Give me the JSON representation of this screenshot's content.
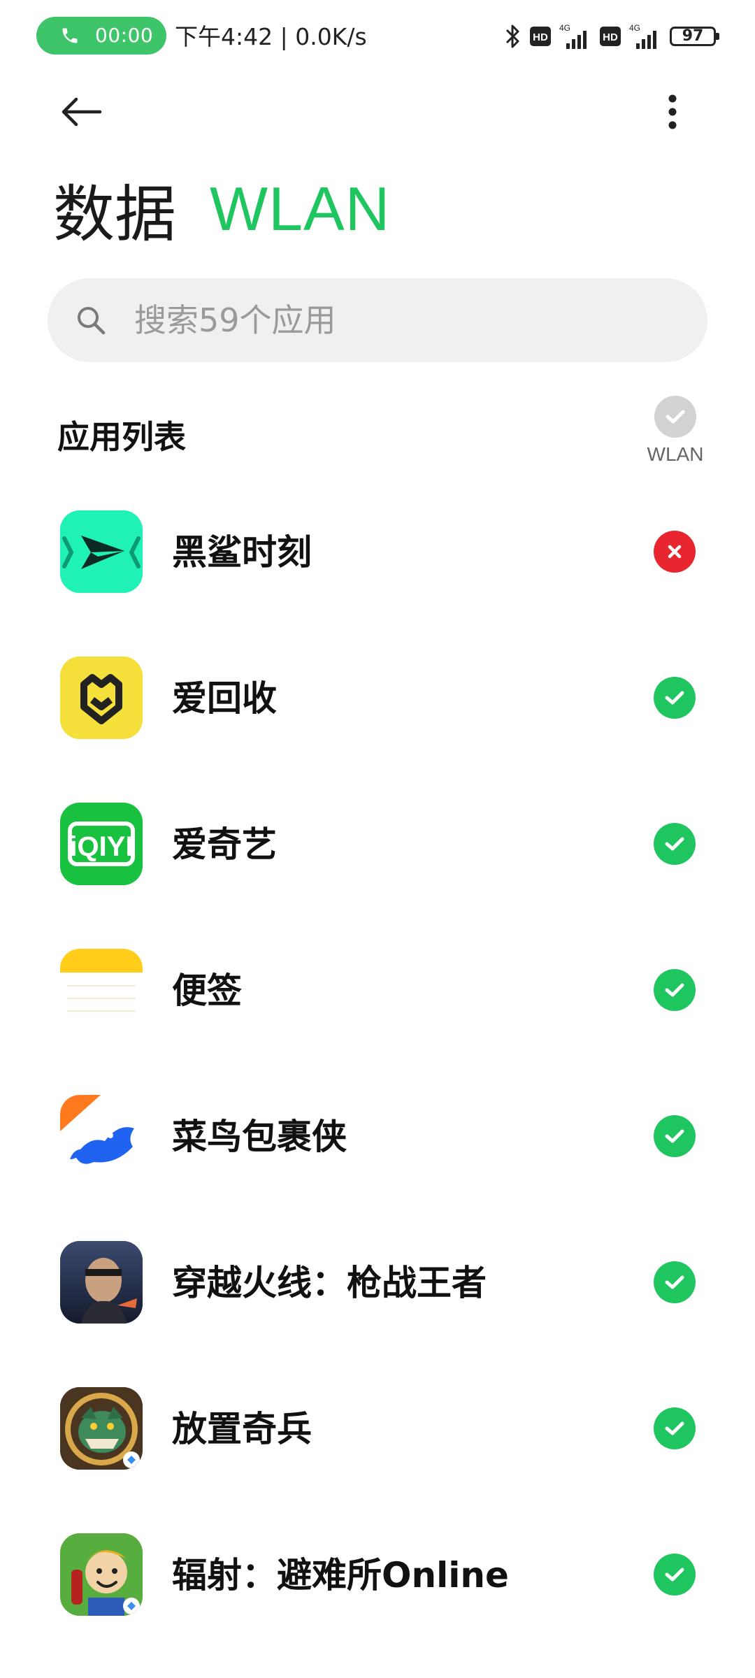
{
  "status_bar": {
    "call_time": "00:00",
    "time_speed": "下午4:42 | 0.0K/s",
    "battery": "97",
    "hd_label": "HD",
    "network_label": "4G"
  },
  "header": {
    "back_icon": "arrow-left-icon",
    "more_icon": "more-vertical-icon",
    "tab_data": "数据",
    "tab_wlan": "WLAN"
  },
  "search": {
    "placeholder": "搜索59个应用",
    "value": ""
  },
  "list": {
    "title": "应用列表",
    "column_label": "WLAN",
    "items": [
      {
        "name": "黑鲨时刻",
        "enabled": false
      },
      {
        "name": "爱回收",
        "enabled": true
      },
      {
        "name": "爱奇艺",
        "enabled": true
      },
      {
        "name": "便签",
        "enabled": true
      },
      {
        "name": "菜鸟包裹侠",
        "enabled": true
      },
      {
        "name": "穿越火线：枪战王者",
        "enabled": true
      },
      {
        "name": "放置奇兵",
        "enabled": true
      },
      {
        "name": "辐射：避难所Online",
        "enabled": true
      }
    ]
  },
  "colors": {
    "accent": "#1fc660",
    "disabled": "#e8262f",
    "call_pill": "#3ec56a"
  }
}
